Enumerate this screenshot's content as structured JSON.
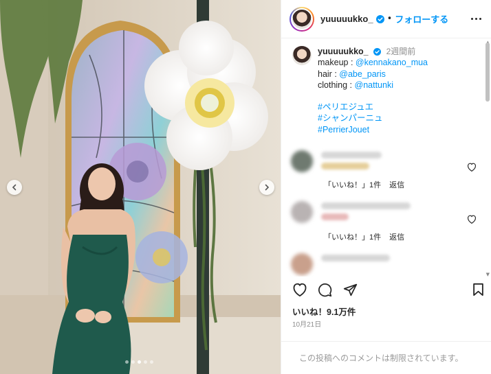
{
  "post": {
    "username": "yuuuuukko_",
    "follow_label": "フォローする",
    "dot_separator": "•",
    "carousel_total_dots": 5,
    "carousel_active_index": 2
  },
  "caption": {
    "username": "yuuuuukko_",
    "time_ago": "2週間前",
    "lines": [
      {
        "prefix": "makeup : ",
        "link": "@kennakano_mua"
      },
      {
        "prefix": "hair : ",
        "link": "@abe_paris"
      },
      {
        "prefix": "clothing : ",
        "link": "@nattunki"
      }
    ],
    "hashtags": [
      "#ペリエジュエ",
      "#シャンパーニュ",
      "#PerrierJouet"
    ]
  },
  "comments": [
    {
      "likes_label": "「いいね！」1件",
      "reply_label": "返信"
    },
    {
      "likes_label": "「いいね！」1件",
      "reply_label": "返信"
    }
  ],
  "footer": {
    "likes": "いいね！9.1万件",
    "date": "10月21日",
    "comments_restricted": "この投稿へのコメントは制限されています。"
  },
  "colors": {
    "accent_blue": "#0095f6",
    "link_blue": "#00376b",
    "dress_green": "#1f5a4c"
  },
  "icons": [
    "chevron-left-icon",
    "chevron-right-icon",
    "verified-badge-icon",
    "more-options-icon",
    "heart-icon",
    "comment-icon",
    "share-icon",
    "bookmark-icon"
  ]
}
